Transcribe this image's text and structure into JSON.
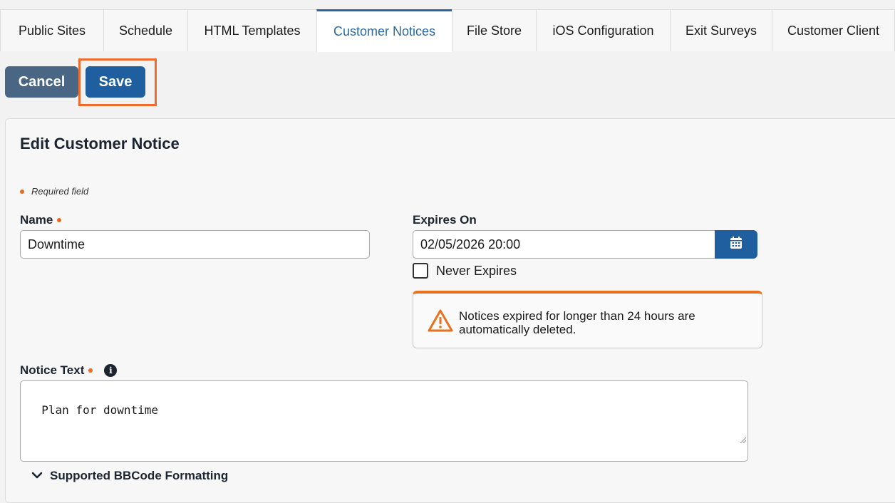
{
  "tabs": [
    {
      "label": "Public Sites",
      "active": false
    },
    {
      "label": "Schedule",
      "active": false
    },
    {
      "label": "HTML Templates",
      "active": false
    },
    {
      "label": "Customer Notices",
      "active": true
    },
    {
      "label": "File Store",
      "active": false
    },
    {
      "label": "iOS Configuration",
      "active": false
    },
    {
      "label": "Exit Surveys",
      "active": false
    },
    {
      "label": "Customer Client",
      "active": false
    }
  ],
  "actions": {
    "cancel_label": "Cancel",
    "save_label": "Save"
  },
  "form": {
    "title": "Edit Customer Notice",
    "required_note": "Required field",
    "name_label": "Name",
    "name_value": "Downtime",
    "expires_label": "Expires On",
    "expires_value": "02/05/2026 20:00",
    "never_expires_label": "Never Expires",
    "never_expires_checked": false,
    "warning_text": "Notices expired for longer than 24 hours are automatically deleted.",
    "notice_text_label": "Notice Text",
    "notice_text_value": "Plan for downtime",
    "bbcode_label": "Supported BBCode Formatting"
  },
  "icons": {
    "calendar": "calendar-icon",
    "warning": "warning-triangle-icon",
    "info": "info-icon",
    "chevron": "chevron-down-icon"
  },
  "colors": {
    "primary": "#1f5fa0",
    "secondary": "#4a6685",
    "accent_orange": "#e8711f",
    "active_tab_text": "#2b6aa3"
  }
}
